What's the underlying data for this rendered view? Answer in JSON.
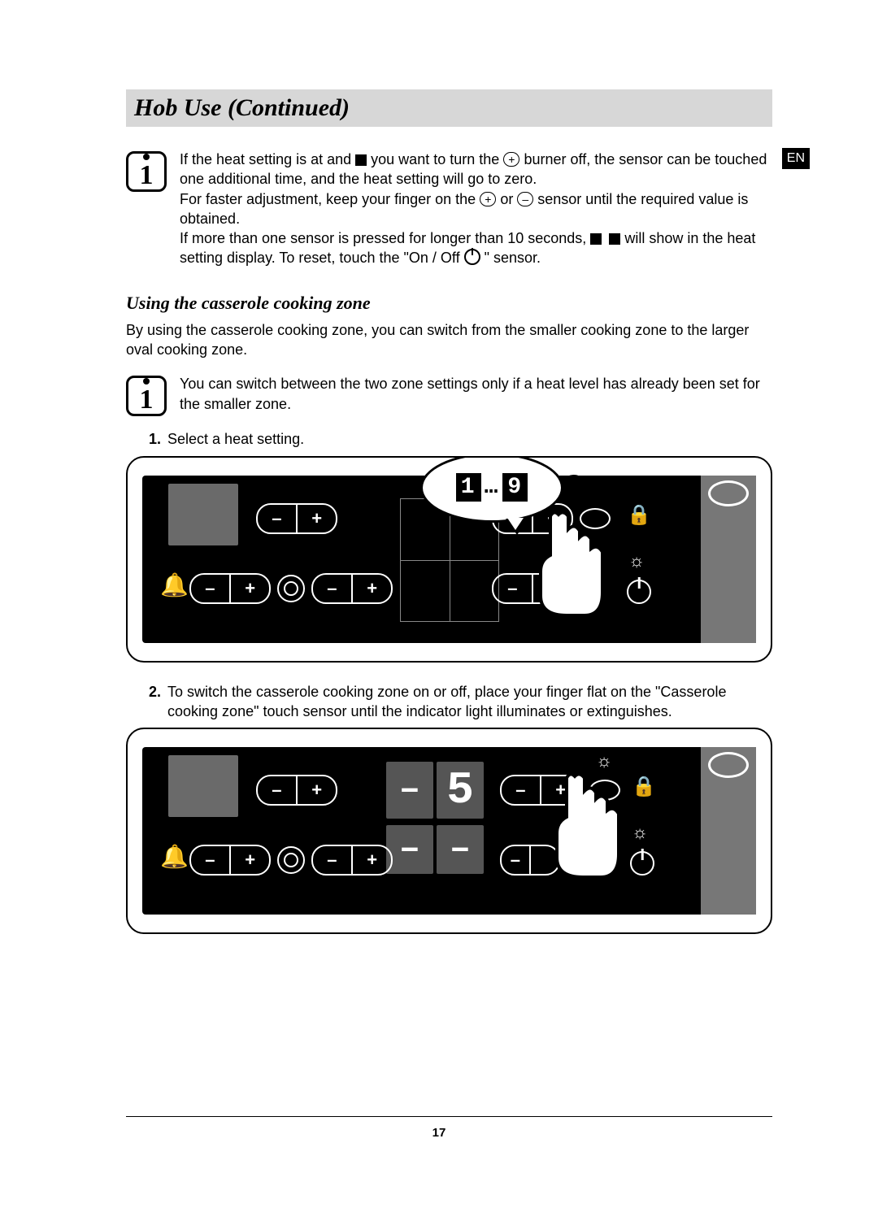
{
  "page": {
    "title": "Hob Use (Continued)",
    "lang_badge": "EN",
    "number": "17"
  },
  "info1": {
    "p1a": "If the heat setting is at and ",
    "p1b": " you want to turn the ",
    "p1c": " burner off, the sensor can be touched one additional time, and the heat setting will go to zero.",
    "p2a": "For faster adjustment, keep your finger on the ",
    "p2b": " or ",
    "p2c": " sensor until the required value is obtained.",
    "p3a": "If more than one sensor is pressed for longer than 10 seconds, ",
    "p3b": " will show in the heat setting display. To reset, touch the \"On / Off ",
    "p3c": "\" sensor."
  },
  "subhead": "Using the casserole cooking zone",
  "intro": "By using the casserole cooking zone, you can switch from the smaller cooking zone to the larger oval cooking zone.",
  "info2": "You can switch between the two zone settings only if a heat level has already been set for the smaller zone.",
  "steps": {
    "s1_num": "1.",
    "s1": "Select a heat setting.",
    "s2_num": "2.",
    "s2": "To switch the casserole cooking zone on or off, place your finger flat on the \"Casserole cooking zone\" touch sensor until the indicator light illuminates or extinguishes."
  },
  "fig1": {
    "bubble_left": "1",
    "bubble_mid": "…",
    "bubble_right": "9"
  },
  "fig2": {
    "display_left": "–",
    "display_right": "5"
  },
  "icons": {
    "minus": "–",
    "plus": "+",
    "bell": "🔔",
    "lock": "🔒",
    "sun": "☼",
    "plus_btn": "+",
    "minus_btn": "–"
  }
}
